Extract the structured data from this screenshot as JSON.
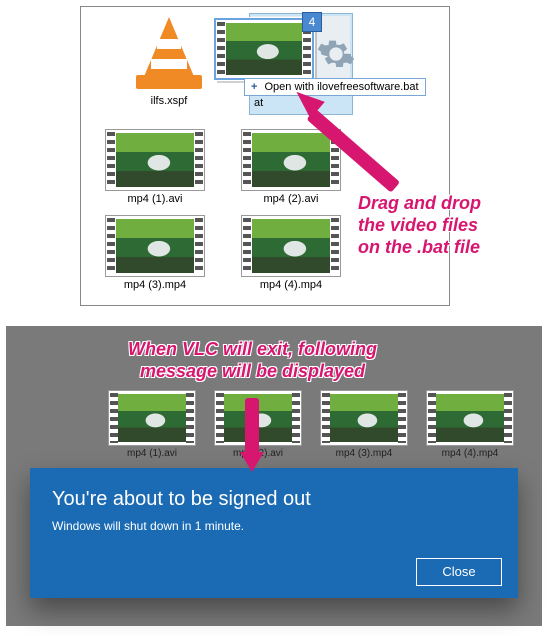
{
  "top": {
    "files": {
      "xspf": {
        "label": "ilfs.xspf"
      },
      "bat": {
        "label": "ilovefreesoftware.bat"
      },
      "v1": {
        "label": "mp4 (1).avi"
      },
      "v2": {
        "label": "mp4 (2).avi"
      },
      "v3": {
        "label": "mp4 (3).mp4"
      },
      "v4": {
        "label": "mp4 (4).mp4"
      }
    },
    "drag": {
      "count": "4",
      "tooltip_prefix": "Open with",
      "tooltip_target": "ilovefreesoftware.bat"
    },
    "annotation_line1": "Drag and drop",
    "annotation_line2": "the video files",
    "annotation_line3": "on the .bat file"
  },
  "bottom": {
    "annotation_line1": "When VLC will exit, following",
    "annotation_line2": "message will be displayed",
    "bg_files": {
      "v1": {
        "label": "mp4 (1).avi"
      },
      "v2": {
        "label": "mp4 (2).avi"
      },
      "v3": {
        "label": "mp4 (3).mp4"
      },
      "v4": {
        "label": "mp4 (4).mp4"
      }
    },
    "dialog": {
      "title": "You're about to be signed out",
      "body": "Windows will shut down in 1 minute.",
      "close": "Close"
    }
  },
  "colors": {
    "accent": "#d6166f",
    "dialog_bg": "#1a6bb3"
  }
}
